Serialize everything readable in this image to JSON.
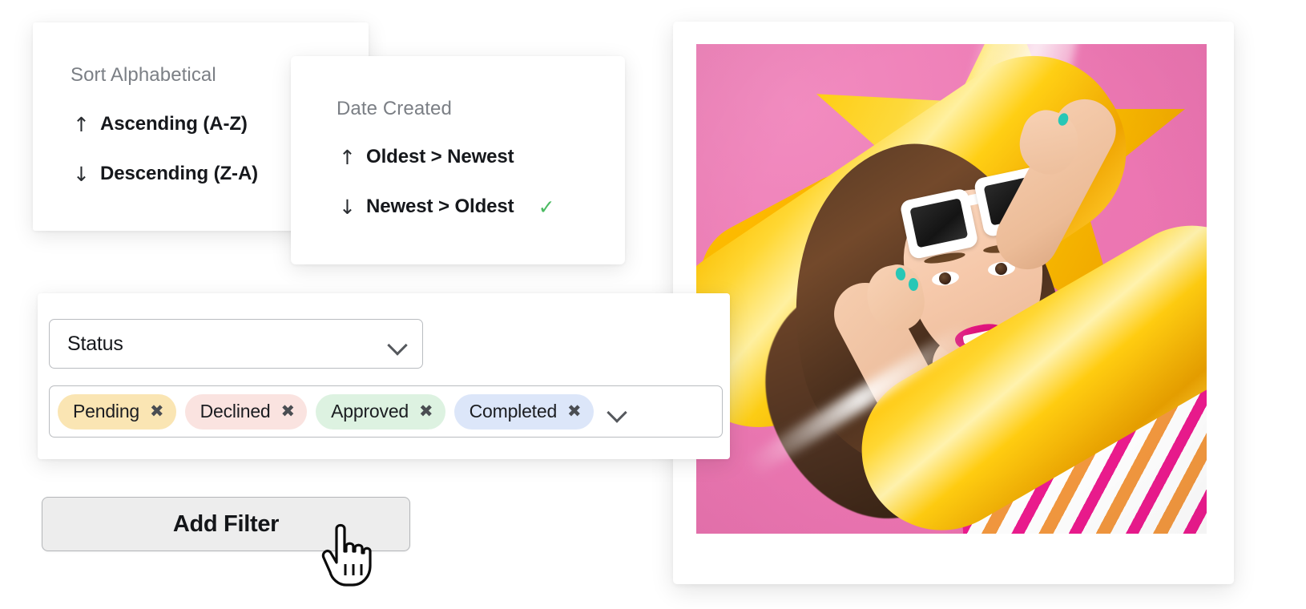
{
  "sort_alphabetical": {
    "heading": "Sort Alphabetical",
    "options": [
      {
        "arrow": "↑",
        "label": "Ascending (A-Z)",
        "selected": false
      },
      {
        "arrow": "↓",
        "label": "Descending (Z-A)",
        "selected": false
      }
    ]
  },
  "sort_date": {
    "heading": "Date Created",
    "options": [
      {
        "arrow": "↑",
        "label": "Oldest > Newest",
        "selected": false
      },
      {
        "arrow": "↓",
        "label": "Newest > Oldest",
        "selected": true
      }
    ],
    "check_glyph": "✓",
    "check_color": "#4cbb63"
  },
  "filter_panel": {
    "field_select": {
      "value": "Status",
      "chevron": "chevron-down-icon"
    },
    "tags": [
      {
        "label": "Pending",
        "bg": "#fae5b3",
        "remove_glyph": "✖"
      },
      {
        "label": "Declined",
        "bg": "#fae3e0",
        "remove_glyph": "✖"
      },
      {
        "label": "Approved",
        "bg": "#ddf2e1",
        "remove_glyph": "✖"
      },
      {
        "label": "Completed",
        "bg": "#dce6f9",
        "remove_glyph": "✖"
      }
    ],
    "tags_chevron": "chevron-down-icon"
  },
  "add_filter": {
    "label": "Add Filter",
    "bg": "#ededed",
    "border": "#b4b6b9"
  },
  "cursor": {
    "type": "pointing-hand-cursor"
  },
  "photo": {
    "alt": "Smiling woman with white square sunglasses on forehead lying on a yellow inflatable star against a pink background, wearing a pink, orange and white diagonally striped swimsuit",
    "background_color": "#ec77b2",
    "inflatable_color": "#ffc800",
    "stripe_pink": "#ec1b8e",
    "stripe_orange": "#f3983f"
  }
}
